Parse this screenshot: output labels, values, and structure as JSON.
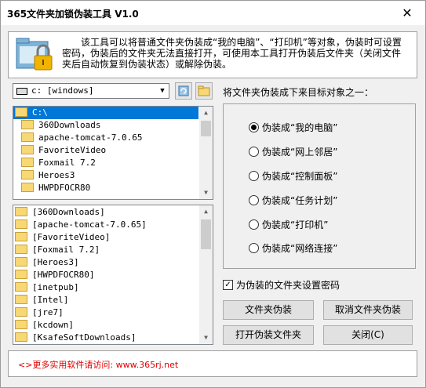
{
  "window": {
    "title": "365文件夹加锁伪装工具 V1.0",
    "close_glyph": "✕"
  },
  "info": {
    "text": "该工具可以将普通文件夹伪装成“我的电脑”、“打印机”等对象，伪装时可设置密码，伪装后的文件夹无法直接打开，可使用本工具打开伪装后文件夹（关闭文件夹后自动恢复到伪装状态）或解除伪装。"
  },
  "drive": {
    "value": "c: [windows]"
  },
  "dir_tree": {
    "items": [
      "C:\\",
      "360Downloads",
      "apache-tomcat-7.0.65",
      "FavoriteVideo",
      "Foxmail 7.2",
      "Heroes3",
      "HWPDFOCR80"
    ],
    "selected": 0
  },
  "subdirs": {
    "items": [
      "[360Downloads]",
      "[apache-tomcat-7.0.65]",
      "[FavoriteVideo]",
      "[Foxmail 7.2]",
      "[Heroes3]",
      "[HWPDFOCR80]",
      "[inetpub]",
      "[Intel]",
      "[jre7]",
      "[kcdown]",
      "[KsafeSoftDownloads]"
    ]
  },
  "target_label": "将文件夹伪装成下来目标对象之一：",
  "options": [
    {
      "label": "伪装成“我的电脑”",
      "checked": true
    },
    {
      "label": "伪装成“网上邻居”",
      "checked": false
    },
    {
      "label": "伪装成“控制面板”",
      "checked": false
    },
    {
      "label": "伪装成“任务计划”",
      "checked": false
    },
    {
      "label": "伪装成“打印机”",
      "checked": false
    },
    {
      "label": "伪装成“网络连接”",
      "checked": false
    }
  ],
  "password_check": {
    "label": "为伪装的文件夹设置密码",
    "checked": true
  },
  "buttons": {
    "disguise": "文件夹伪装",
    "cancel_disguise": "取消文件夹伪装",
    "open": "打开伪装文件夹",
    "close": "关闭(C)"
  },
  "footer": {
    "text": "<>更多实用软件请访问: www.365rj.net"
  },
  "colors": {
    "footer_text": "#e00000",
    "selection": "#0078d7"
  }
}
